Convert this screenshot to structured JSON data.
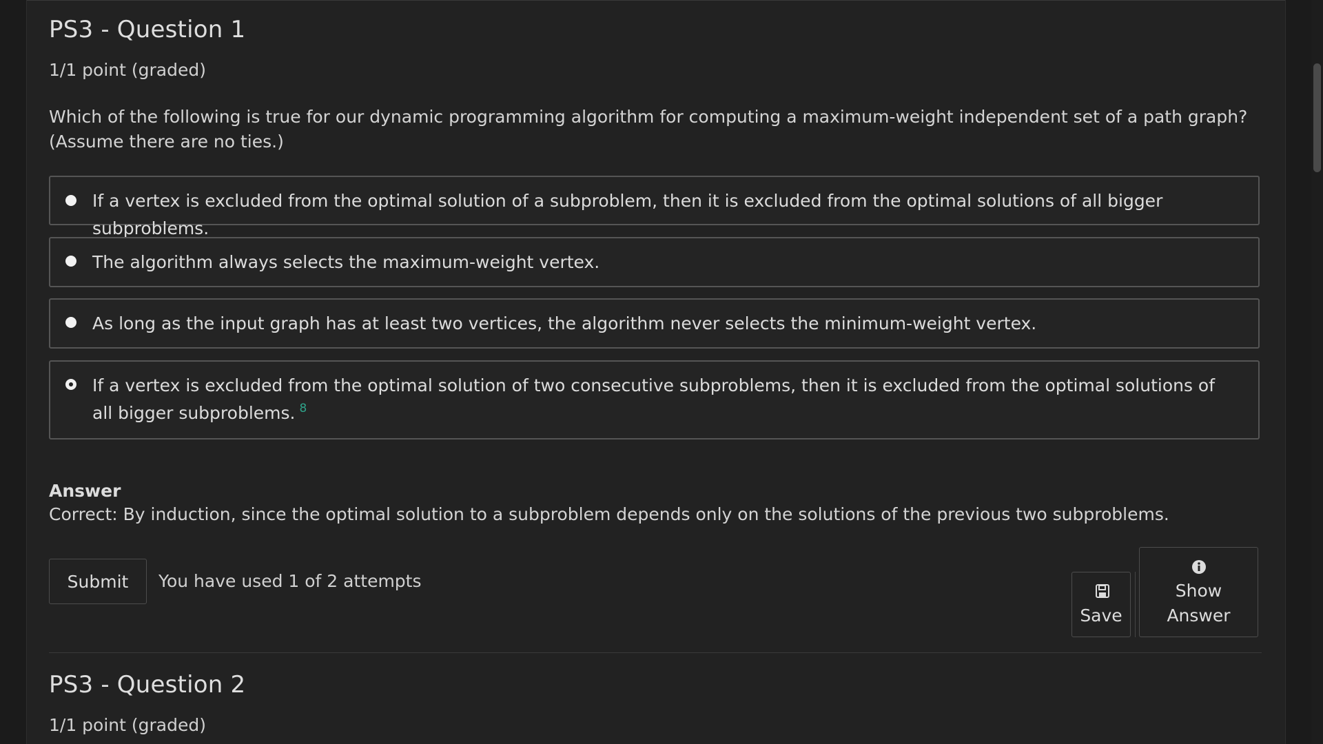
{
  "question1": {
    "title": "PS3 - Question 1",
    "points": "1/1 point (graded)",
    "prompt": "Which of the following is true for our dynamic programming algorithm for computing a maximum-weight independent set of a path graph? (Assume there are no ties.)",
    "choices": [
      {
        "text": "If a vertex is excluded from the optimal solution of a subproblem, then it is excluded from the optimal solutions of all bigger subproblems.",
        "selected": false
      },
      {
        "text": "The algorithm always selects the maximum-weight vertex.",
        "selected": false
      },
      {
        "text": "As long as the input graph has at least two vertices, the algorithm never selects the minimum-weight vertex.",
        "selected": false
      },
      {
        "text": "If a vertex is excluded from the optimal solution of two consecutive subproblems, then it is excluded from the optimal solutions of all bigger subproblems.",
        "selected": true
      }
    ],
    "correct_marker": "8",
    "answer_label": "Answer",
    "answer_text": "Correct:  By induction, since the optimal solution to a subproblem depends only on the solutions of the previous two subproblems.",
    "submit_label": "Submit",
    "attempts_text": "You have used 1 of 2 attempts",
    "save_label": "Save",
    "show_answer_line1": "Show",
    "show_answer_line2": "Answer"
  },
  "question2": {
    "title": "PS3 - Question 2",
    "points": "1/1 point (graded)"
  },
  "icons": {
    "save": "floppy-disk-icon",
    "show_answer": "info-circle-icon"
  },
  "colors": {
    "background": "#222222",
    "correct_marker": "#2fa38a",
    "border": "#555555"
  }
}
